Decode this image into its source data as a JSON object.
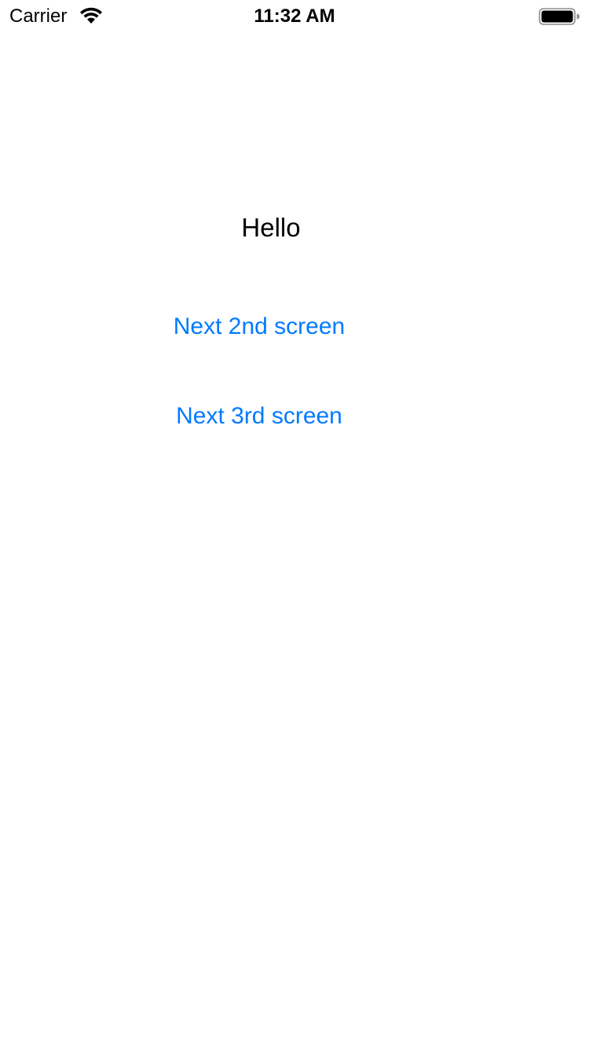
{
  "status_bar": {
    "carrier": "Carrier",
    "time": "11:32 AM",
    "wifi_icon": "wifi-icon",
    "battery_icon": "battery-icon"
  },
  "main": {
    "greeting": "Hello",
    "buttons": [
      {
        "label": "Next 2nd screen"
      },
      {
        "label": "Next 3rd screen"
      }
    ]
  },
  "colors": {
    "background": "#ffffff",
    "text": "#000000",
    "accent": "#007aff"
  }
}
